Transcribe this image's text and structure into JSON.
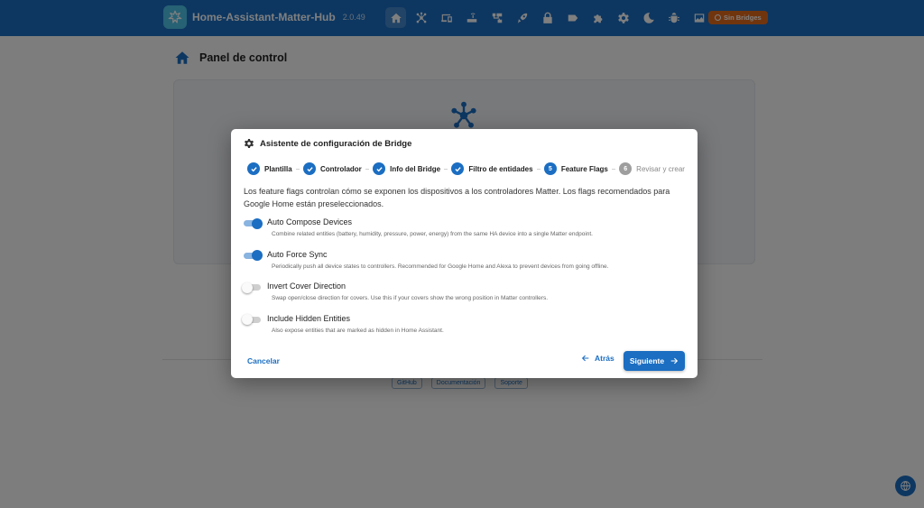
{
  "app": {
    "title": "Home-Assistant-Matter-Hub",
    "version": "2.0.49",
    "status_chip": "Sin Bridges"
  },
  "nav": [
    {
      "icon": "home-icon",
      "active": true
    },
    {
      "icon": "hub-icon"
    },
    {
      "icon": "devices-icon"
    },
    {
      "icon": "router-icon"
    },
    {
      "icon": "network-icon"
    },
    {
      "icon": "rocket-icon"
    },
    {
      "icon": "lock-icon"
    },
    {
      "icon": "label-icon"
    },
    {
      "icon": "puzzle-icon"
    },
    {
      "icon": "gear-icon"
    },
    {
      "icon": "moon-icon"
    },
    {
      "icon": "bug-icon"
    },
    {
      "icon": "image-icon"
    }
  ],
  "page": {
    "title": "Panel de control"
  },
  "footer": {
    "links": [
      "GitHub",
      "Documentación",
      "Soporte"
    ]
  },
  "dialog": {
    "title": "Asistente de configuración de Bridge",
    "steps": [
      {
        "label": "Plantilla",
        "state": "done"
      },
      {
        "label": "Controlador",
        "state": "done"
      },
      {
        "label": "Info del Bridge",
        "state": "done"
      },
      {
        "label": "Filtro de entidades",
        "state": "done"
      },
      {
        "label": "Feature Flags",
        "state": "active",
        "number": "5"
      },
      {
        "label": "Revisar y crear",
        "state": "pending",
        "number": "6"
      }
    ],
    "intro": "Los feature flags controlan cómo se exponen los dispositivos a los controladores Matter. Los flags recomendados para Google Home están preseleccionados.",
    "flags": [
      {
        "title": "Auto Compose Devices",
        "description": "Combine related entities (battery, humidity, pressure, power, energy) from the same HA device into a single Matter endpoint.",
        "enabled": true
      },
      {
        "title": "Auto Force Sync",
        "description": "Periodically push all device states to controllers. Recommended for Google Home and Alexa to prevent devices from going offline.",
        "enabled": true
      },
      {
        "title": "Invert Cover Direction",
        "description": "Swap open/close direction for covers. Use this if your covers show the wrong position in Matter controllers.",
        "enabled": false
      },
      {
        "title": "Include Hidden Entities",
        "description": "Also expose entities that are marked as hidden in Home Assistant.",
        "enabled": false
      }
    ],
    "cancel_label": "Cancelar",
    "back_label": "Atrás",
    "next_label": "Siguiente"
  },
  "colors": {
    "primary": "#1b6ec2",
    "warning": "#e26a1c",
    "pending": "#9e9e9e"
  }
}
